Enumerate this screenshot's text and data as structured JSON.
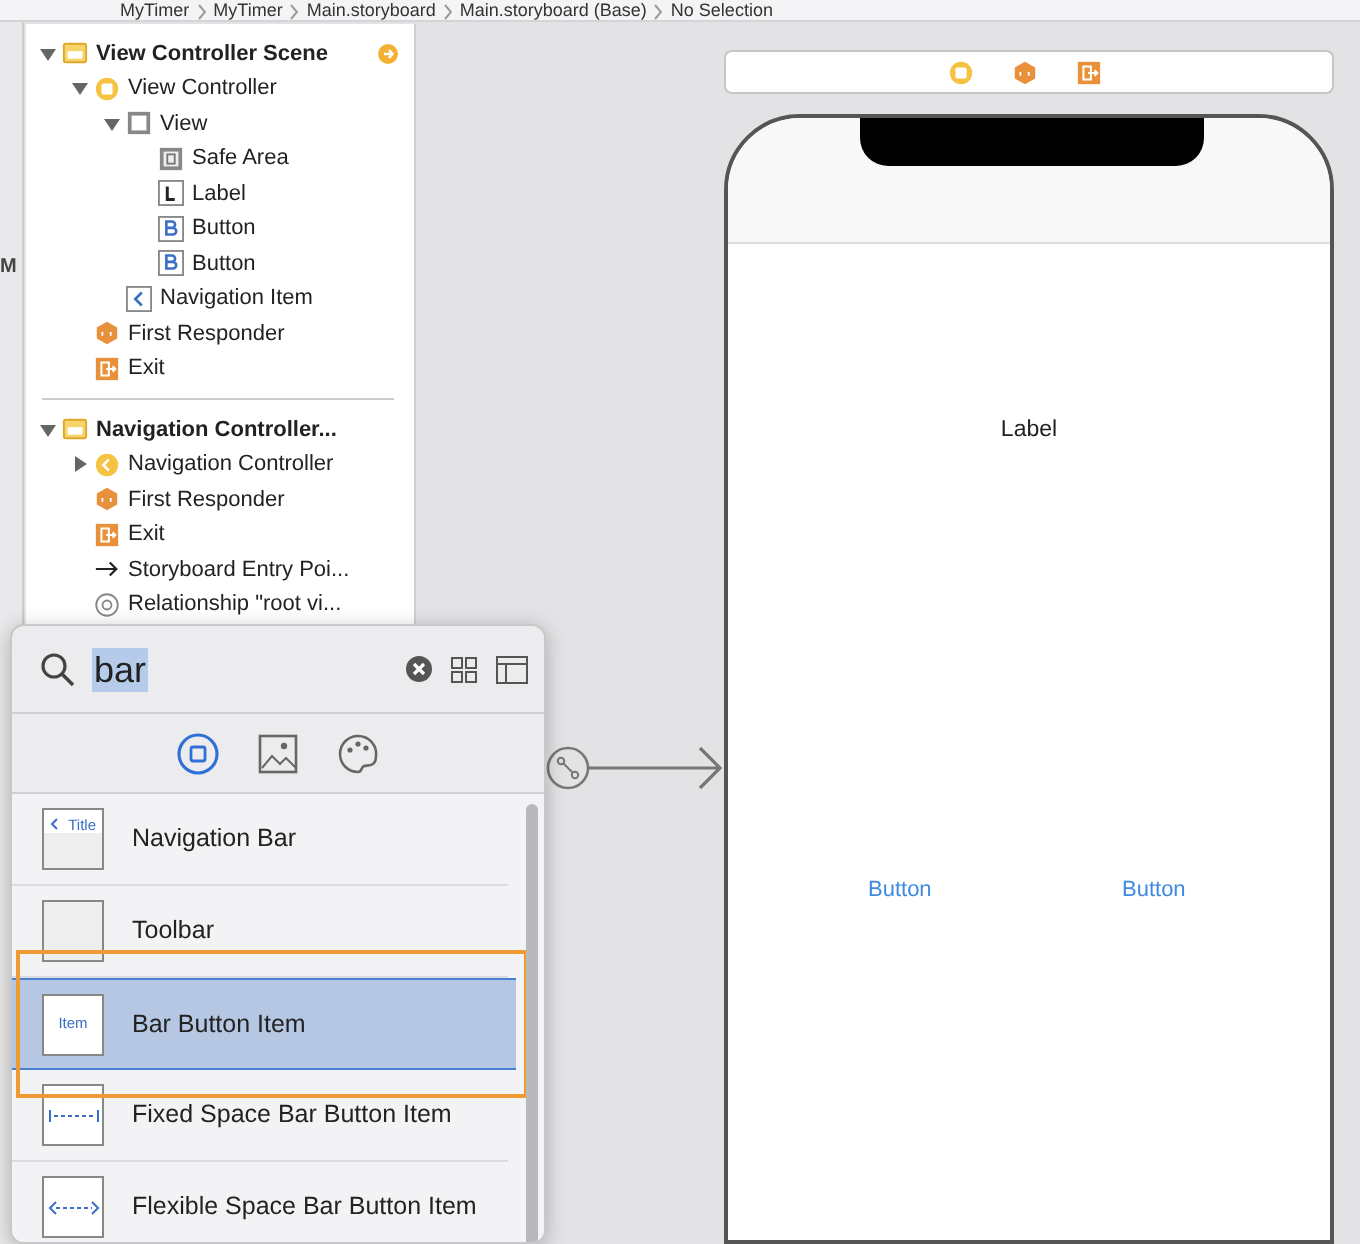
{
  "breadcrumb": [
    "MyTimer",
    "MyTimer",
    "Main.storyboard",
    "Main.storyboard (Base)",
    "No Selection"
  ],
  "side_strip": {
    "letter": "M"
  },
  "outline": [
    {
      "label": "View Controller Scene",
      "kind": "scene",
      "expanded": true,
      "badge": true,
      "children": [
        {
          "label": "View Controller",
          "kind": "vc",
          "expanded": true,
          "children": [
            {
              "label": "View",
              "kind": "view",
              "expanded": true,
              "children": [
                {
                  "label": "Safe Area",
                  "kind": "safearea"
                },
                {
                  "label": "Label",
                  "kind": "label"
                },
                {
                  "label": "Button",
                  "kind": "button"
                },
                {
                  "label": "Button",
                  "kind": "button"
                }
              ]
            },
            {
              "label": "Navigation Item",
              "kind": "navitem"
            }
          ]
        },
        {
          "label": "First Responder",
          "kind": "responder"
        },
        {
          "label": "Exit",
          "kind": "exit"
        }
      ]
    },
    {
      "label": "Navigation Controller...",
      "kind": "scene",
      "expanded": true,
      "badge": false,
      "children": [
        {
          "label": "Navigation Controller",
          "kind": "navcontroller",
          "expanded": false
        },
        {
          "label": "First Responder",
          "kind": "responder"
        },
        {
          "label": "Exit",
          "kind": "exit"
        },
        {
          "label": "Storyboard Entry Poi...",
          "kind": "entry"
        },
        {
          "label": "Relationship \"root vi...",
          "kind": "relationship"
        }
      ]
    }
  ],
  "library": {
    "search": {
      "value": "bar"
    },
    "tabs": [
      {
        "kind": "objects",
        "selected": true
      },
      {
        "kind": "media",
        "selected": false
      },
      {
        "kind": "colors",
        "selected": false
      }
    ],
    "items": [
      {
        "label": "Navigation Bar",
        "kind": "navbar",
        "thumb_text": "Title",
        "selected": false,
        "outlined": false
      },
      {
        "label": "Toolbar",
        "kind": "toolbar",
        "selected": false,
        "outlined": false
      },
      {
        "label": "Bar Button Item",
        "kind": "item",
        "thumb_text": "Item",
        "selected": true,
        "outlined": true
      },
      {
        "label": "Fixed Space Bar Button Item",
        "kind": "fixed",
        "selected": false,
        "outlined": false
      },
      {
        "label": "Flexible Space Bar Button Item",
        "kind": "flexible",
        "selected": false,
        "outlined": false
      }
    ]
  },
  "canvas": {
    "scene_bar": [
      {
        "kind": "vc"
      },
      {
        "kind": "responder"
      },
      {
        "kind": "exit"
      }
    ],
    "phone": {
      "label": "Label",
      "buttons": [
        "Button",
        "Button"
      ]
    }
  }
}
